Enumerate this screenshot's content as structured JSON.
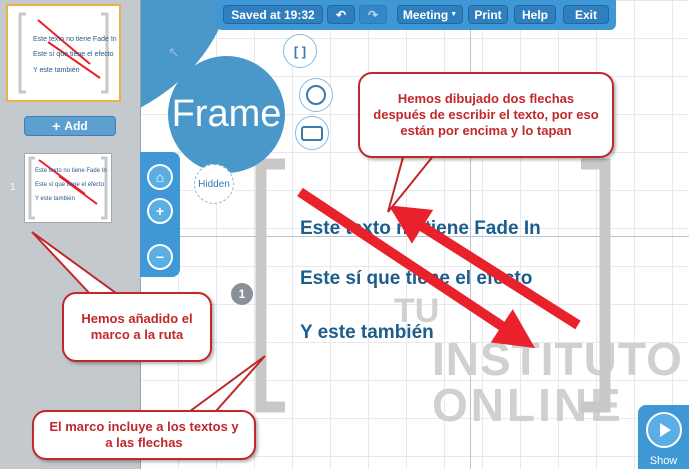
{
  "toolbar": {
    "saved_label": "Saved at 19:32",
    "meeting_label": "Meeting",
    "print_label": "Print",
    "help_label": "Help",
    "exit_label": "Exit"
  },
  "sidebar": {
    "add_label": "Add",
    "slide_number": "1",
    "thumbnail_lines": [
      "Este texto no tiene Fade In",
      "Este sí que tiene el efecto",
      "Y este también"
    ]
  },
  "tools": {
    "frame_label": "Frame",
    "hidden_label": "Hidden",
    "bracket_label": "[ ]"
  },
  "slide": {
    "line1": "Este texto no tiene Fade In",
    "line2": "Este sí que tiene el efecto",
    "line3": "Y este también",
    "path_number": "1"
  },
  "watermark": {
    "top": "TU",
    "middle": "INSTITUTO",
    "bottom": "ONLINE"
  },
  "callouts": {
    "arrows": "Hemos dibujado dos flechas después de escribir el texto, por eso están por encima y lo tapan",
    "added": "Hemos añadido el marco a la ruta",
    "includes": "El marco incluye a los textos y a las flechas"
  },
  "show_label": "Show",
  "colors": {
    "accent": "#3f97d6",
    "callout": "#c0282a",
    "slide_text": "#1d5d8c",
    "arrow": "#e8212a"
  }
}
